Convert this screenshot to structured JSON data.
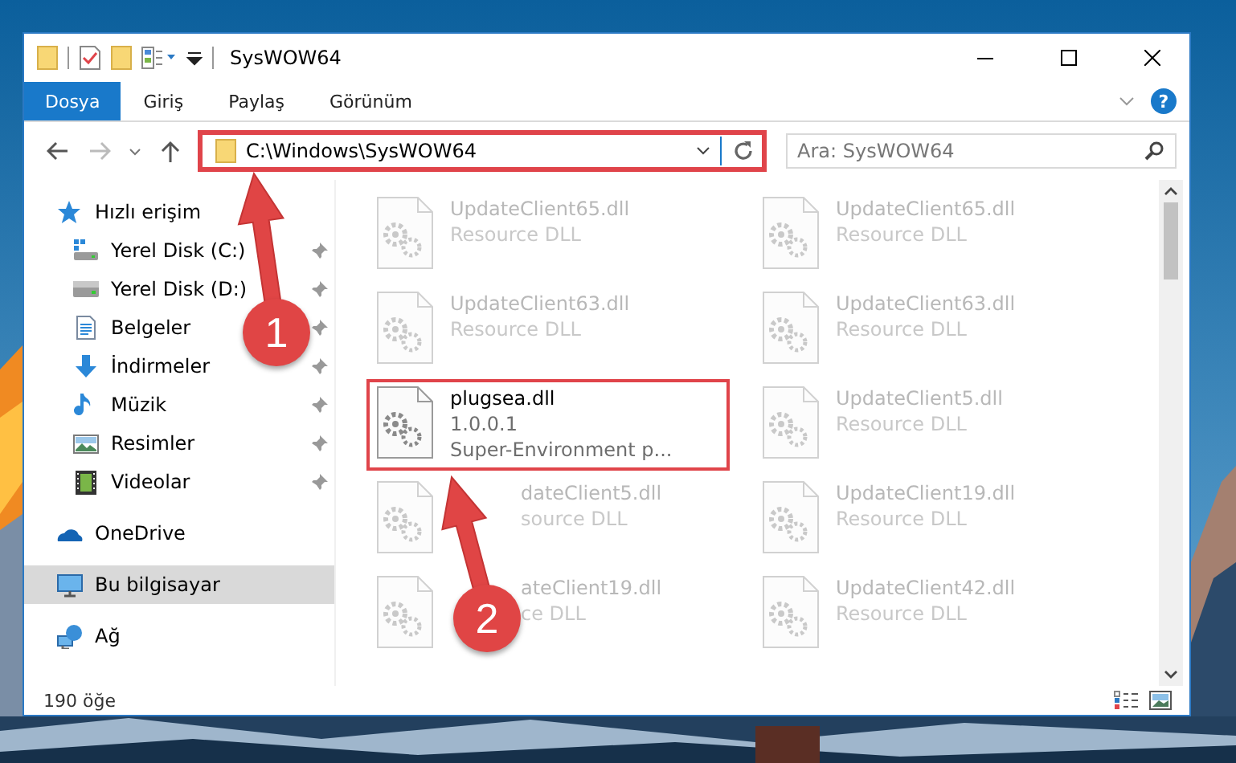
{
  "window": {
    "title": "SysWOW64"
  },
  "ribbon": {
    "tabs": [
      {
        "label": "Dosya",
        "selected": true
      },
      {
        "label": "Giriş",
        "selected": false
      },
      {
        "label": "Paylaş",
        "selected": false
      },
      {
        "label": "Görünüm",
        "selected": false
      }
    ],
    "help": "?"
  },
  "address": {
    "value": "C:\\Windows\\SysWOW64",
    "highlighted": true
  },
  "search": {
    "placeholder": "Ara: SysWOW64"
  },
  "sidebar": {
    "items": [
      {
        "label": "Hızlı erişim",
        "kind": "star",
        "selected": false,
        "children": [
          {
            "label": "Yerel Disk (C:)",
            "kind": "system-drive",
            "pinned": true,
            "selected": false
          },
          {
            "label": "Yerel Disk (D:)",
            "kind": "drive",
            "pinned": true,
            "selected": false
          },
          {
            "label": "Belgeler",
            "kind": "documents",
            "pinned": true,
            "selected": false
          },
          {
            "label": "İndirmeler",
            "kind": "download",
            "pinned": true,
            "selected": false
          },
          {
            "label": "Müzik",
            "kind": "music",
            "pinned": true,
            "selected": false
          },
          {
            "label": "Resimler",
            "kind": "pictures",
            "pinned": true,
            "selected": false
          },
          {
            "label": "Videolar",
            "kind": "videos",
            "pinned": true,
            "selected": false
          }
        ]
      },
      {
        "label": "OneDrive",
        "kind": "cloud",
        "selected": false
      },
      {
        "label": "Bu bilgisayar",
        "kind": "computer",
        "selected": true
      },
      {
        "label": "Ağ",
        "kind": "network",
        "selected": false
      }
    ]
  },
  "files": [
    {
      "name": "UpdateClient65.dll",
      "details": [
        "Resource DLL"
      ],
      "blurred": true,
      "highlighted": false
    },
    {
      "name": "UpdateClient65.dll",
      "details": [
        "Resource DLL"
      ],
      "blurred": true,
      "highlighted": false
    },
    {
      "name": "UpdateClient63.dll",
      "details": [
        "Resource DLL"
      ],
      "blurred": true,
      "highlighted": false
    },
    {
      "name": "UpdateClient63.dll",
      "details": [
        "Resource DLL"
      ],
      "blurred": true,
      "highlighted": false
    },
    {
      "name": "plugsea.dll",
      "details": [
        "1.0.0.1",
        "Super-Environment p..."
      ],
      "blurred": false,
      "highlighted": true
    },
    {
      "name": "UpdateClient5.dll",
      "details": [
        "Resource DLL"
      ],
      "blurred": true,
      "highlighted": false
    },
    {
      "name": "dateClient5.dll",
      "details": [
        "source DLL"
      ],
      "blurred": true,
      "highlighted": false,
      "partly_hidden": true
    },
    {
      "name": "UpdateClient19.dll",
      "details": [
        "Resource DLL"
      ],
      "blurred": true,
      "highlighted": false
    },
    {
      "name": "ateClient19.dll",
      "details": [
        "ce DLL"
      ],
      "blurred": true,
      "highlighted": false,
      "partly_hidden": true
    },
    {
      "name": "UpdateClient42.dll",
      "details": [
        "Resource DLL"
      ],
      "blurred": true,
      "highlighted": false
    }
  ],
  "status_bar": {
    "count": "190 öğe"
  },
  "annotations": [
    {
      "number": "1"
    },
    {
      "number": "2"
    }
  ]
}
